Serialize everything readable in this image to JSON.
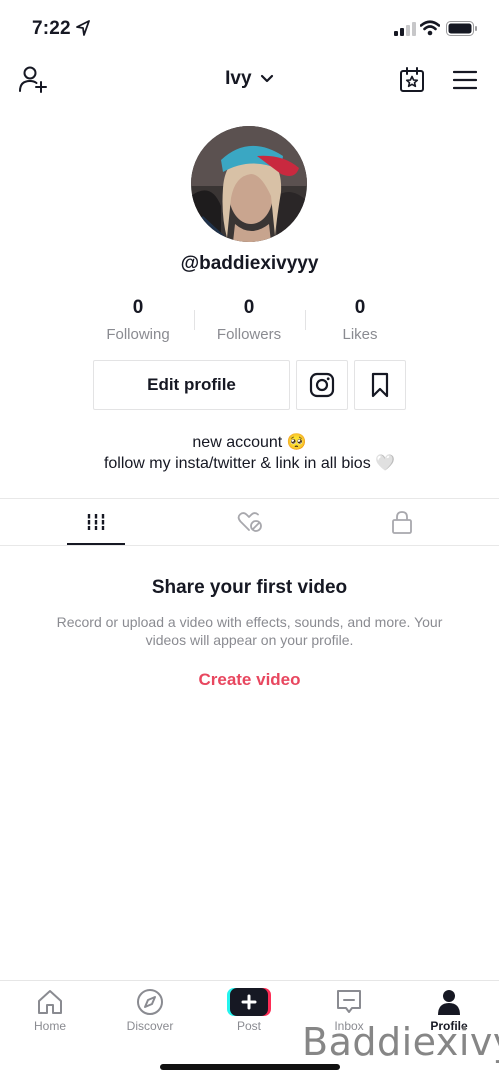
{
  "status": {
    "time": "7:22"
  },
  "header": {
    "title": "Ivy"
  },
  "profile": {
    "username": "@baddiexivyyy",
    "stats": [
      {
        "value": "0",
        "label": "Following"
      },
      {
        "value": "0",
        "label": "Followers"
      },
      {
        "value": "0",
        "label": "Likes"
      }
    ],
    "edit_label": "Edit profile",
    "bio_line1": "new account 🥺",
    "bio_line2": "follow my insta/twitter & link in all bios 🤍"
  },
  "empty_state": {
    "title": "Share your first video",
    "description": "Record or upload a video with effects, sounds, and more. Your videos will appear on your profile.",
    "cta": "Create video"
  },
  "nav": {
    "items": [
      {
        "label": "Home",
        "icon": "home-icon"
      },
      {
        "label": "Discover",
        "icon": "compass-icon"
      },
      {
        "label": "Post",
        "icon": "plus-icon"
      },
      {
        "label": "Inbox",
        "icon": "inbox-icon"
      },
      {
        "label": "Profile",
        "icon": "profile-icon"
      }
    ]
  },
  "watermark": "Baddiexivy",
  "colors": {
    "accent": "#e8475f",
    "text": "#161823",
    "muted": "#8a8b91"
  }
}
